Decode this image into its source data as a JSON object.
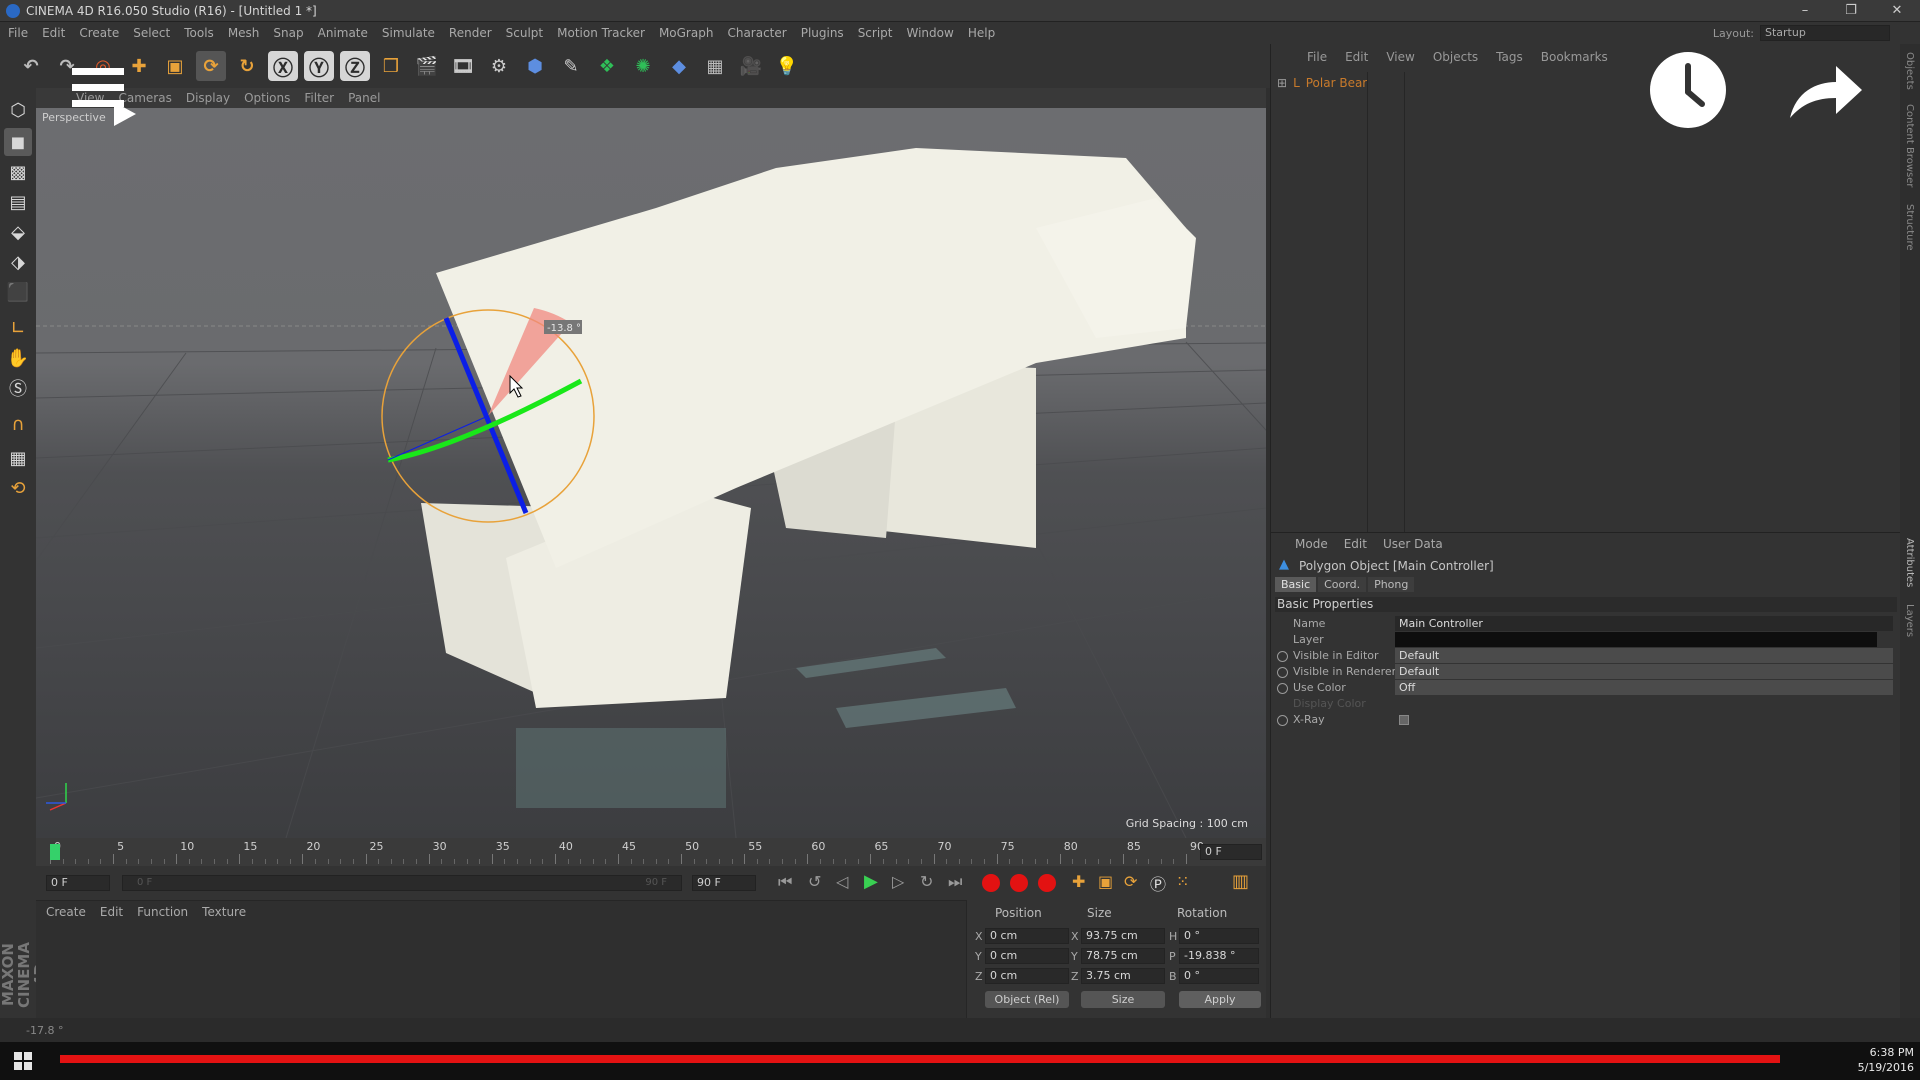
{
  "window": {
    "title": "CINEMA 4D R16.050 Studio (R16) - [Untitled 1 *]",
    "controls": [
      "–",
      "❐",
      "✕"
    ]
  },
  "menubar": {
    "items": [
      "File",
      "Edit",
      "Create",
      "Select",
      "Tools",
      "Mesh",
      "Snap",
      "Animate",
      "Simulate",
      "Render",
      "Sculpt",
      "Motion Tracker",
      "MoGraph",
      "Character",
      "Plugins",
      "Script",
      "Window",
      "Help"
    ],
    "layout_label": "Layout:",
    "layout_value": "Startup"
  },
  "viewport": {
    "menu": [
      "View",
      "Cameras",
      "Display",
      "Options",
      "Filter",
      "Panel"
    ],
    "label": "Perspective",
    "grid_spacing": "Grid Spacing : 100 cm",
    "rotation_readout": "-13.8 °"
  },
  "timeline": {
    "ticks": [
      "0",
      "5",
      "10",
      "15",
      "20",
      "25",
      "30",
      "35",
      "40",
      "45",
      "50",
      "55",
      "60",
      "65",
      "70",
      "75",
      "80",
      "85",
      "90"
    ],
    "current_frame_field": "0 F",
    "start_field": "0 F",
    "range_start": "0 F",
    "range_end": "90 F",
    "end_field": "90 F"
  },
  "material_manager": {
    "menu": [
      "Create",
      "Edit",
      "Function",
      "Texture"
    ]
  },
  "coordinates": {
    "headers": [
      "Position",
      "Size",
      "Rotation"
    ],
    "rows": [
      {
        "axis": "X",
        "pos": "0 cm",
        "size_axis": "X",
        "size": "93.75 cm",
        "rot_axis": "H",
        "rot": "0 °"
      },
      {
        "axis": "Y",
        "pos": "0 cm",
        "size_axis": "Y",
        "size": "78.75 cm",
        "rot_axis": "P",
        "rot": "-19.838 °"
      },
      {
        "axis": "Z",
        "pos": "0 cm",
        "size_axis": "Z",
        "size": "3.75 cm",
        "rot_axis": "B",
        "rot": "0 °"
      }
    ],
    "mode_dropdown": "Object (Rel)",
    "size_dropdown": "Size",
    "apply_label": "Apply"
  },
  "object_manager": {
    "menu": [
      "File",
      "Edit",
      "View",
      "Objects",
      "Tags",
      "Bookmarks"
    ],
    "objects": [
      {
        "name": "Polar Bear"
      }
    ]
  },
  "attributes": {
    "menu": [
      "Mode",
      "Edit",
      "User Data"
    ],
    "object_title": "Polygon Object [Main Controller]",
    "tabs": [
      "Basic",
      "Coord.",
      "Phong"
    ],
    "section": "Basic Properties",
    "props": [
      {
        "label": "Name",
        "value": "Main Controller"
      },
      {
        "label": "Layer",
        "value": ""
      },
      {
        "label": "Visible in Editor",
        "value": "Default"
      },
      {
        "label": "Visible in Renderer",
        "value": "Default"
      },
      {
        "label": "Use Color",
        "value": "Off"
      },
      {
        "label": "Display Color",
        "value": ""
      },
      {
        "label": "X-Ray",
        "value": ""
      }
    ]
  },
  "right_tabs": [
    "Objects",
    "Content Browser",
    "Structure",
    "Attributes",
    "Layers"
  ],
  "statusbar": {
    "text": "-17.8 °"
  },
  "brand": {
    "text": "MAXON CINEMA 4D"
  },
  "taskbar": {
    "time": "6:38 PM",
    "date": "5/19/2016"
  },
  "colors": {
    "accent_orange": "#e8a23a",
    "axis_blue": "#0b1ee6",
    "axis_green": "#19e819",
    "record_red": "#e31212"
  }
}
